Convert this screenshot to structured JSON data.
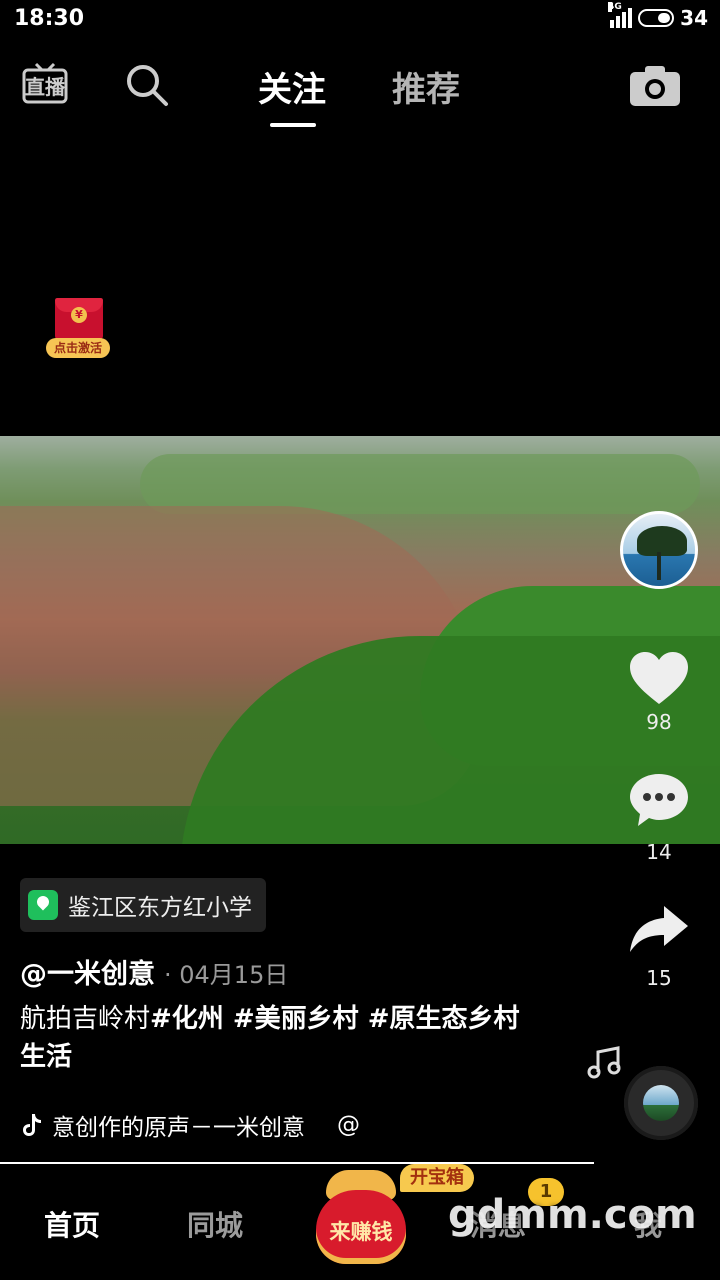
{
  "status_bar": {
    "time": "18:30",
    "network": "4G",
    "battery": "34"
  },
  "top_nav": {
    "live_icon": "直播",
    "tabs": [
      {
        "label": "关注",
        "active": true
      },
      {
        "label": "推荐",
        "active": false
      }
    ]
  },
  "red_packet": {
    "coin": "¥",
    "label": "点击激活"
  },
  "video": {
    "location": "鉴江区东方红小学",
    "author": "@一米创意",
    "date": "· 04月15日",
    "description_plain": "航拍吉岭村",
    "hashtags": "#化州 #美丽乡村 #原生态乡村生活",
    "music": "意创作的原声－一米创意",
    "music_at": "@"
  },
  "actions": {
    "likes": "98",
    "comments": "14",
    "shares": "15"
  },
  "bottom_nav": {
    "home": "首页",
    "city": "同城",
    "earn": "来赚钱",
    "treasure": "开宝箱",
    "messages": "消息",
    "messages_badge": "1",
    "me": "我"
  },
  "watermark": "gdmm.com",
  "colors": {
    "accent_green": "#1fbf5c",
    "badge_yellow": "#f6c22d",
    "earn_red": "#d81b2c"
  }
}
